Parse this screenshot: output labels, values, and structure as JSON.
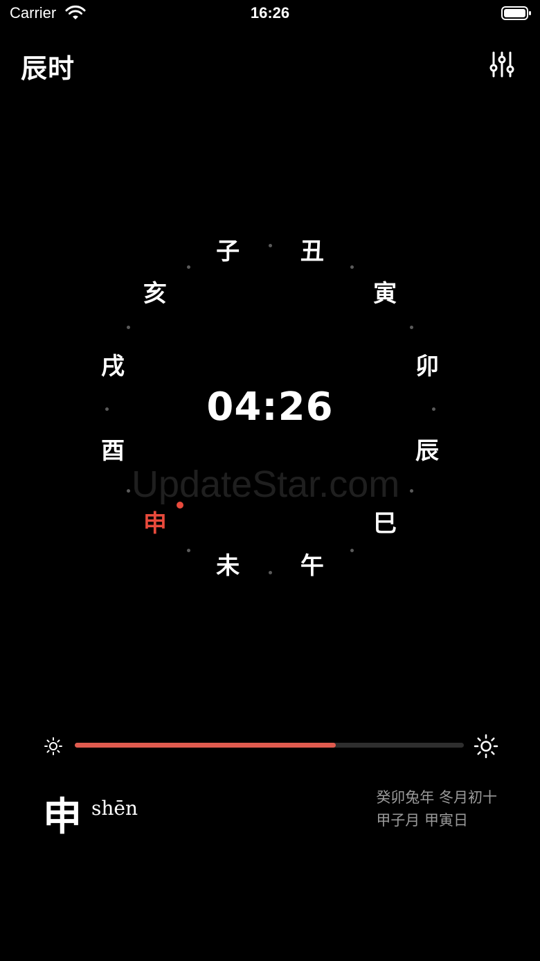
{
  "status_bar": {
    "carrier": "Carrier",
    "time": "16:26"
  },
  "header": {
    "title": "辰时",
    "settings_icon": "sliders-icon"
  },
  "dial": {
    "branches": [
      "子",
      "丑",
      "寅",
      "卯",
      "辰",
      "巳",
      "午",
      "未",
      "申",
      "酉",
      "戌",
      "亥"
    ],
    "active_branch": "申",
    "clock": "04:26",
    "active_color": "#e84a3c"
  },
  "watermark": "UpdateStar.com",
  "brightness": {
    "level": 0.67,
    "low_icon": "sun-small-icon",
    "high_icon": "sun-large-icon",
    "fill_color": "#e05b4f"
  },
  "footer": {
    "character": "申",
    "pinyin": "shēn",
    "lunar_line1": "癸卯兔年 冬月初十",
    "lunar_line2": "甲子月 甲寅日"
  }
}
